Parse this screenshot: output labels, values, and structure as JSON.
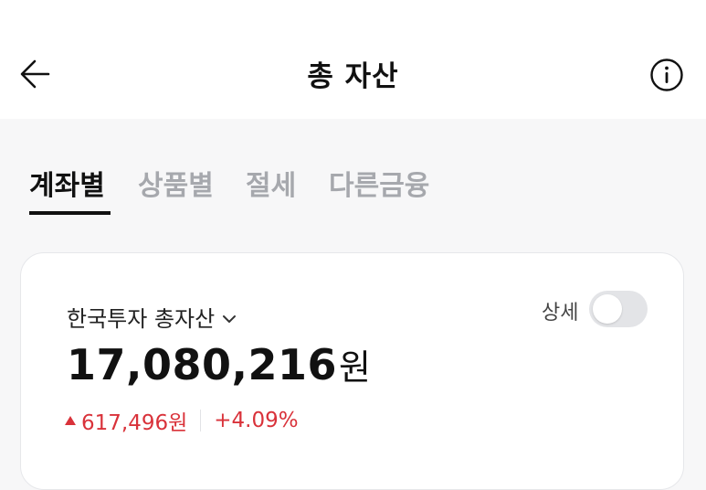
{
  "header": {
    "title": "총 자산"
  },
  "icons": {
    "back": "arrow-left-icon",
    "info": "info-circle-icon",
    "dropdown": "chevron-down-icon",
    "up": "triangle-up-icon"
  },
  "tabs": [
    {
      "label": "계좌별",
      "active": true
    },
    {
      "label": "상품별",
      "active": false
    },
    {
      "label": "절세",
      "active": false
    },
    {
      "label": "다른금융",
      "active": false
    }
  ],
  "card": {
    "account_label": "한국투자 총자산",
    "detail_label": "상세",
    "detail_toggle_on": false,
    "total_amount": "17,080,216",
    "total_unit": "원",
    "change_amount": "617,496원",
    "change_percent": "+4.09%"
  },
  "colors": {
    "accent_active": "#111111",
    "inactive_tab": "#a6a8ad",
    "positive": "#d9323a",
    "background": "#f7f7f8"
  }
}
